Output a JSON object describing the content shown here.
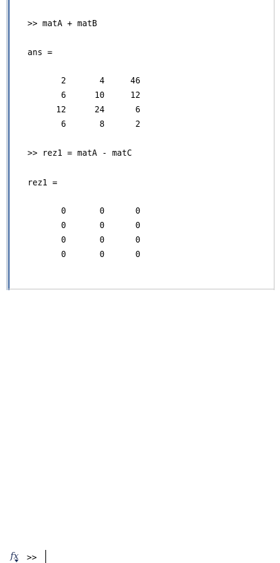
{
  "console": {
    "command_1": ">> matA + matB",
    "result_1_label": "ans =",
    "result_1_rows": [
      [
        "2",
        "4",
        "46"
      ],
      [
        "6",
        "10",
        "12"
      ],
      [
        "12",
        "24",
        "6"
      ],
      [
        "6",
        "8",
        "2"
      ]
    ],
    "command_2": ">> rez1 = matA - matC",
    "result_2_label": "rez1 =",
    "result_2_rows": [
      [
        "0",
        "0",
        "0"
      ],
      [
        "0",
        "0",
        "0"
      ],
      [
        "0",
        "0",
        "0"
      ],
      [
        "0",
        "0",
        "0"
      ]
    ],
    "prompt": ">>"
  },
  "icons": {
    "function_browser": "fx-icon"
  },
  "colors": {
    "accent_border": "#4d72a8",
    "background": "#ffffff",
    "text": "#000000"
  }
}
